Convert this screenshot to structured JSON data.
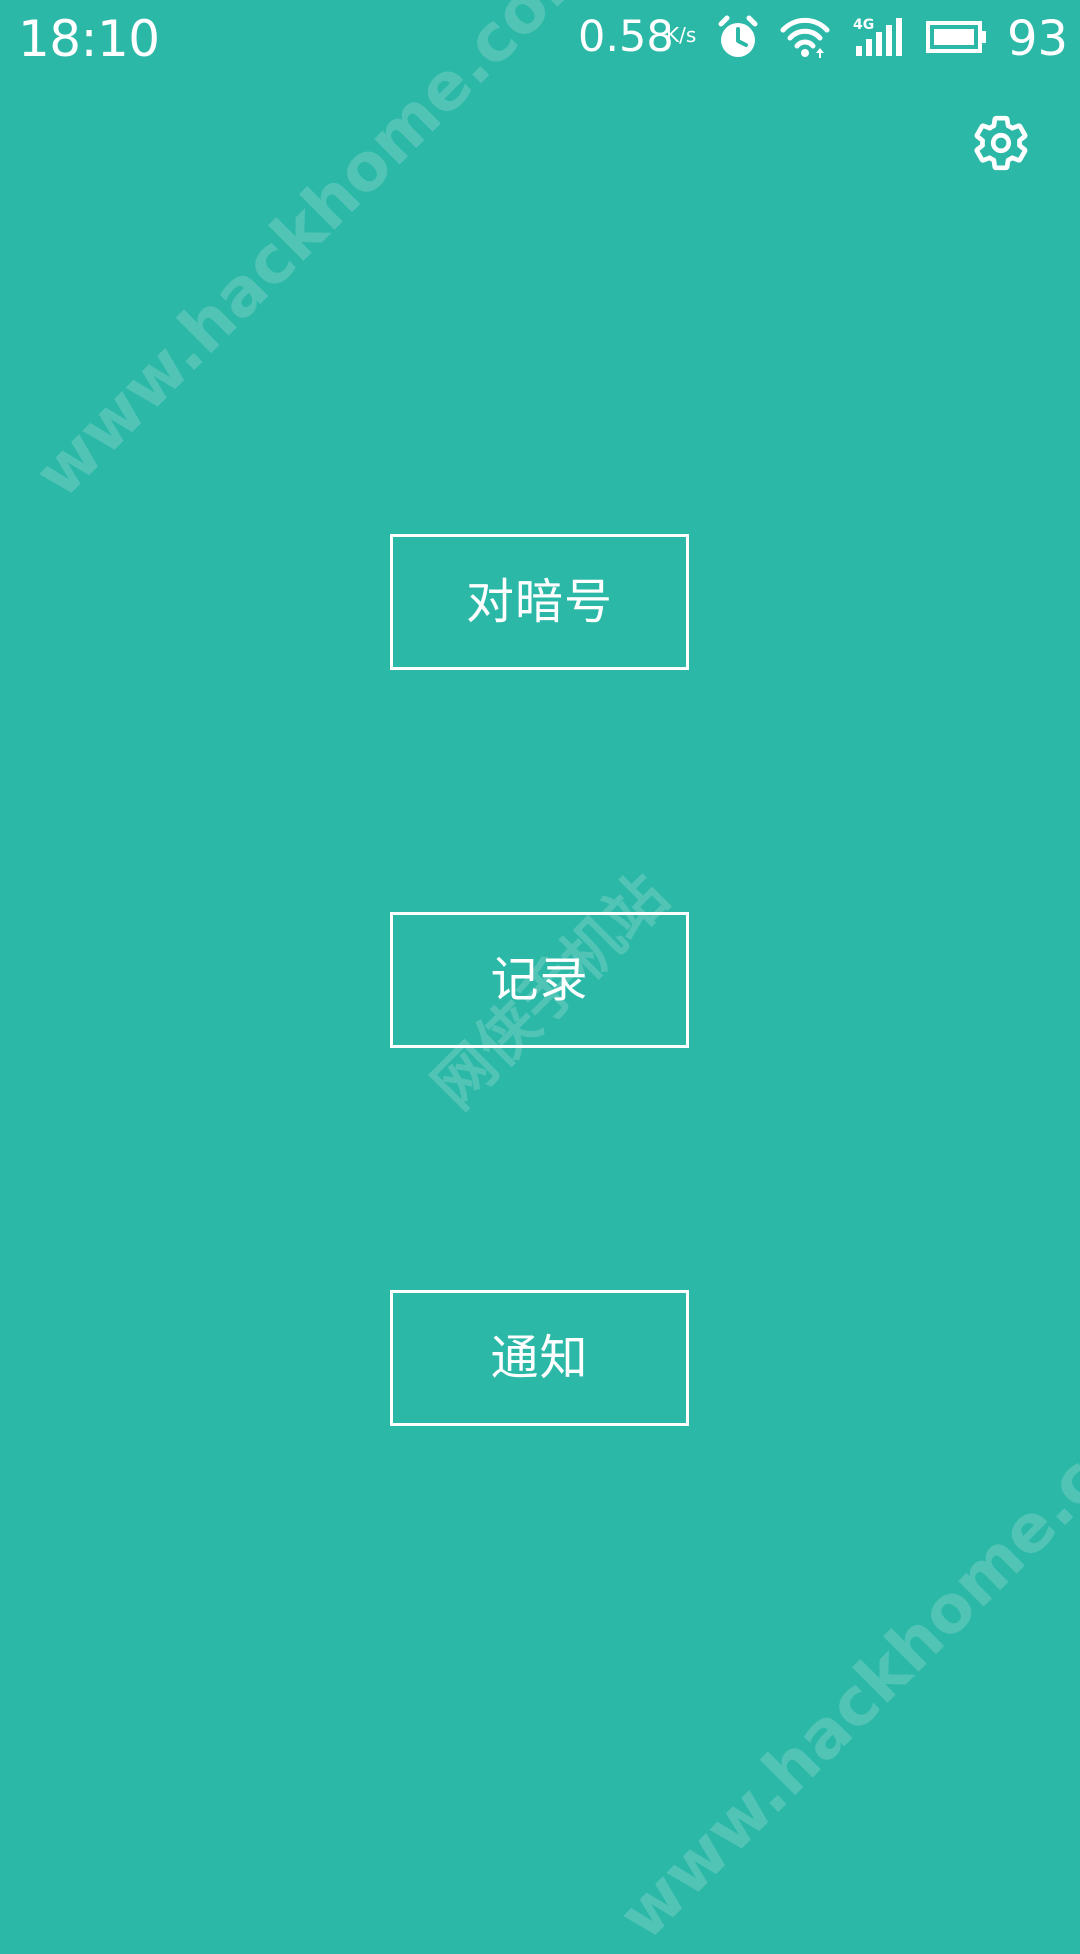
{
  "status_bar": {
    "time": "18:10",
    "network_speed": "0.58",
    "network_unit": "K/s",
    "battery_level": "93",
    "icons": [
      "alarm-clock-icon",
      "wifi-icon",
      "signal-4g-icon",
      "battery-icon"
    ]
  },
  "settings": {
    "icon": "gear-icon"
  },
  "buttons": [
    {
      "label": "对暗号"
    },
    {
      "label": "记录"
    },
    {
      "label": "通知"
    }
  ],
  "watermarks": [
    "www.hackhome.com",
    "www.hackhome.com",
    "网侠手机站"
  ],
  "colors": {
    "background": "#2bb8a7",
    "foreground": "#ffffff"
  }
}
